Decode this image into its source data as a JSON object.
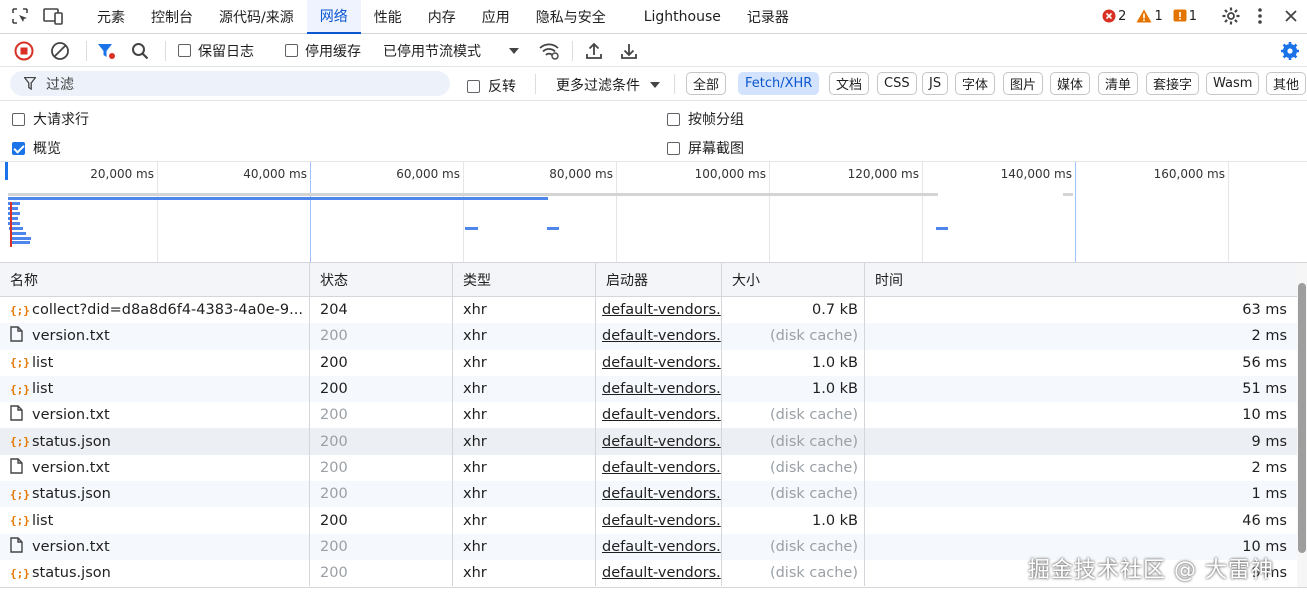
{
  "tabbar": {
    "tabs": [
      "元素",
      "控制台",
      "源代码/来源",
      "网络",
      "性能",
      "内存",
      "应用",
      "隐私与安全",
      "Lighthouse",
      "记录器"
    ],
    "active_tab": "网络",
    "errors": "2",
    "warnings": "1",
    "issues": "1"
  },
  "toolbar": {
    "preserve_log": "保留日志",
    "disable_cache": "停用缓存",
    "throttling": "已停用节流模式"
  },
  "filter": {
    "placeholder": "过滤",
    "invert": "反转",
    "more_filters": "更多过滤条件",
    "chips": [
      "全部",
      "Fetch/XHR",
      "文档",
      "CSS",
      "JS",
      "字体",
      "图片",
      "媒体",
      "清单",
      "套接字",
      "Wasm",
      "其他"
    ],
    "active_chip": "Fetch/XHR"
  },
  "options": {
    "big_rows": "大请求行",
    "overview": "概览",
    "group_by_frame": "按帧分组",
    "screenshots": "屏幕截图"
  },
  "overview": {
    "ticks": [
      "20,000 ms",
      "40,000 ms",
      "60,000 ms",
      "80,000 ms",
      "100,000 ms",
      "120,000 ms",
      "140,000 ms",
      "160,000 ms"
    ]
  },
  "table": {
    "columns": [
      "名称",
      "状态",
      "类型",
      "启动器",
      "大小",
      "时间"
    ],
    "rows": [
      {
        "icon": "xhr",
        "name": "collect?did=d8a8d6f4-4383-4a0e-9...",
        "status": "204",
        "type": "xhr",
        "initiator": "default-vendors.",
        "size": "0.7 kB",
        "time": "63 ms",
        "dim": false
      },
      {
        "icon": "doc",
        "name": "version.txt",
        "status": "200",
        "type": "xhr",
        "initiator": "default-vendors.",
        "size": "(disk cache)",
        "time": "2 ms",
        "dim": true
      },
      {
        "icon": "xhr",
        "name": "list",
        "status": "200",
        "type": "xhr",
        "initiator": "default-vendors.",
        "size": "1.0 kB",
        "time": "56 ms",
        "dim": false
      },
      {
        "icon": "xhr",
        "name": "list",
        "status": "200",
        "type": "xhr",
        "initiator": "default-vendors.",
        "size": "1.0 kB",
        "time": "51 ms",
        "dim": false
      },
      {
        "icon": "doc",
        "name": "version.txt",
        "status": "200",
        "type": "xhr",
        "initiator": "default-vendors.",
        "size": "(disk cache)",
        "time": "10 ms",
        "dim": true
      },
      {
        "icon": "xhr",
        "name": "status.json",
        "status": "200",
        "type": "xhr",
        "initiator": "default-vendors.",
        "size": "(disk cache)",
        "time": "9 ms",
        "dim": true
      },
      {
        "icon": "doc",
        "name": "version.txt",
        "status": "200",
        "type": "xhr",
        "initiator": "default-vendors.",
        "size": "(disk cache)",
        "time": "2 ms",
        "dim": true
      },
      {
        "icon": "xhr",
        "name": "status.json",
        "status": "200",
        "type": "xhr",
        "initiator": "default-vendors.",
        "size": "(disk cache)",
        "time": "1 ms",
        "dim": true
      },
      {
        "icon": "xhr",
        "name": "list",
        "status": "200",
        "type": "xhr",
        "initiator": "default-vendors.",
        "size": "1.0 kB",
        "time": "46 ms",
        "dim": false
      },
      {
        "icon": "doc",
        "name": "version.txt",
        "status": "200",
        "type": "xhr",
        "initiator": "default-vendors.",
        "size": "(disk cache)",
        "time": "10 ms",
        "dim": true
      },
      {
        "icon": "xhr",
        "name": "status.json",
        "status": "200",
        "type": "xhr",
        "initiator": "default-vendors.",
        "size": "(disk cache)",
        "time": "9 ms",
        "dim": true
      }
    ]
  },
  "watermark": "掘金技术社区 @ 大雷神"
}
